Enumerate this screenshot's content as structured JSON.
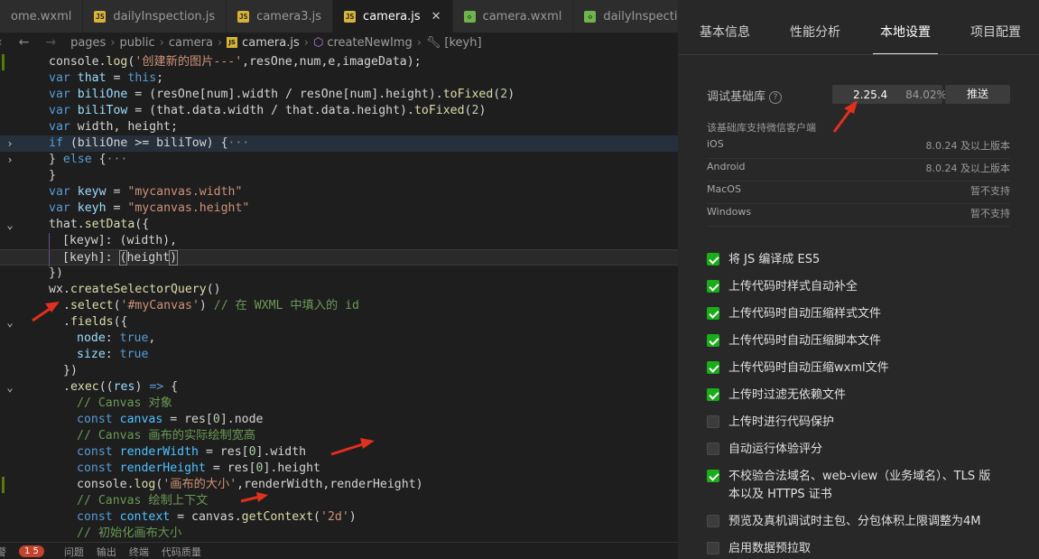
{
  "tabs": [
    {
      "name": "home.wxml",
      "label": "ome.wxml",
      "icon": "wxml-file-icon",
      "type": "wx",
      "active": false
    },
    {
      "name": "dailyInspection.js",
      "label": "dailyInspection.js",
      "icon": "js-file-icon",
      "type": "js",
      "active": false
    },
    {
      "name": "camera3.js",
      "label": "camera3.js",
      "icon": "js-file-icon",
      "type": "js",
      "active": false
    },
    {
      "name": "camera.js",
      "label": "camera.js",
      "icon": "js-file-icon",
      "type": "js",
      "active": true
    },
    {
      "name": "camera.wxml",
      "label": "camera.wxml",
      "icon": "wxml-file-icon",
      "type": "wx",
      "active": false
    },
    {
      "name": "dailyInspection.wxml",
      "label": "dailyInspection.wx",
      "icon": "wxml-file-icon",
      "type": "wx",
      "active": false
    }
  ],
  "breadcrumb": {
    "parts": [
      "pages",
      "public",
      "camera",
      "camera.js",
      "createNewImg",
      "[keyh]"
    ]
  },
  "code_lines": [
    "console.log('创建新的图片---',resOne,num,e,imageData);",
    "var that = this;",
    "var biliOne = (resOne[num].width / resOne[num].height).toFixed(2)",
    "var biliTow = (that.data.width / that.data.height).toFixed(2)",
    "var width, height;",
    "if (biliOne >= biliTow) {···",
    "} else {···",
    "}",
    "var keyw = \"mycanvas.width\"",
    "var keyh = \"mycanvas.height\"",
    "that.setData({",
    "  [keyw]: (width),",
    "  [keyh]: (height)",
    "})",
    "wx.createSelectorQuery()",
    "  .select('#myCanvas') // 在 WXML 中填入的 id",
    "  .fields({",
    "    node: true,",
    "    size: true",
    "  })",
    "  .exec((res) => {",
    "    // Canvas 对象",
    "    const canvas = res[0].node",
    "    // Canvas 画布的实际绘制宽高",
    "    const renderWidth = res[0].width",
    "    const renderHeight = res[0].height",
    "    console.log('画布的大小',renderWidth,renderHeight)",
    "    // Canvas 绘制上下文",
    "    const context = canvas.getContext('2d')",
    "    // 初始化画布大小"
  ],
  "statusbar": {
    "lead": "警",
    "count": "1 5",
    "problems": "问题",
    "output": "输出",
    "terminal": "终端",
    "quality": "代码质量"
  },
  "panel": {
    "tabs": [
      "基本信息",
      "性能分析",
      "本地设置",
      "项目配置"
    ],
    "active_tab": "本地设置",
    "lib_label": "调试基础库",
    "lib_version": "2.25.4",
    "lib_percent": "84.02%",
    "push_label": "推送",
    "support_text": "该基础库支持微信客户端",
    "platforms": [
      {
        "name": "iOS",
        "value": "8.0.24 及以上版本"
      },
      {
        "name": "Android",
        "value": "8.0.24 及以上版本"
      },
      {
        "name": "MacOS",
        "value": "暂不支持"
      },
      {
        "name": "Windows",
        "value": "暂不支持"
      }
    ],
    "options": [
      {
        "label": "将 JS 编译成 ES5",
        "checked": true
      },
      {
        "label": "上传代码时样式自动补全",
        "checked": true
      },
      {
        "label": "上传代码时自动压缩样式文件",
        "checked": true
      },
      {
        "label": "上传代码时自动压缩脚本文件",
        "checked": true
      },
      {
        "label": "上传代码时自动压缩wxml文件",
        "checked": true
      },
      {
        "label": "上传时过滤无依赖文件",
        "checked": true
      },
      {
        "label": "上传时进行代码保护",
        "checked": false
      },
      {
        "label": "自动运行体验评分",
        "checked": false
      },
      {
        "label": "不校验合法域名、web-view（业务域名）、TLS 版本以及 HTTPS 证书",
        "checked": true
      },
      {
        "label": "预览及真机调试时主包、分包体积上限调整为4M",
        "checked": false
      },
      {
        "label": "启用数据预拉取",
        "checked": false
      }
    ]
  },
  "colors": {
    "accent_check": "#1aad19",
    "arrow": "#e0301e"
  }
}
